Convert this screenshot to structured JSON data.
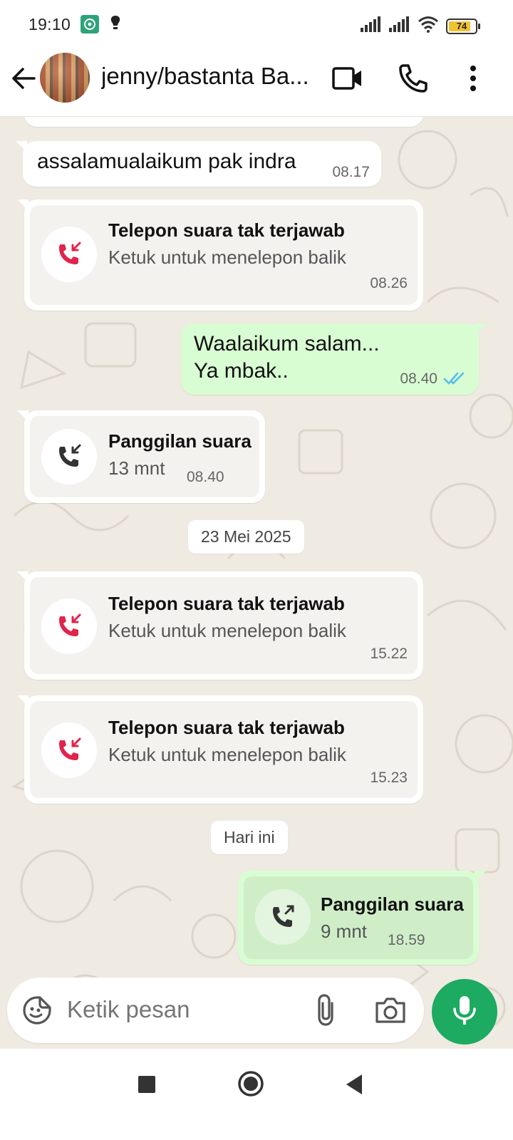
{
  "status_bar": {
    "time": "19:10",
    "battery_level": "74",
    "icons": [
      "hotspot-app-icon",
      "lightbulb-icon",
      "signal-icon",
      "signal-icon",
      "wifi-icon",
      "battery-icon"
    ]
  },
  "header": {
    "contact_name": "jenny/bastanta Ba...",
    "icons": [
      "back-arrow-icon",
      "video-call-icon",
      "phone-icon",
      "more-vert-icon"
    ]
  },
  "messages": [
    {
      "type": "text",
      "direction": "in",
      "text": "assalamualaikum pak indra",
      "time": "08.17"
    },
    {
      "type": "missed_call",
      "direction": "in",
      "title": "Telepon suara tak terjawab",
      "subtitle": "Ketuk untuk menelepon balik",
      "time": "08.26"
    },
    {
      "type": "text",
      "direction": "out",
      "lines": [
        "Waalaikum salam...",
        "Ya mbak.."
      ],
      "time": "08.40",
      "status": "read"
    },
    {
      "type": "call",
      "direction": "in",
      "title": "Panggilan suara",
      "subtitle": "13 mnt",
      "time": "08.40"
    },
    {
      "type": "missed_call",
      "direction": "in",
      "title": "Telepon suara tak terjawab",
      "subtitle": "Ketuk untuk menelepon balik",
      "time": "15.22"
    },
    {
      "type": "missed_call",
      "direction": "in",
      "title": "Telepon suara tak terjawab",
      "subtitle": "Ketuk untuk menelepon balik",
      "time": "15.23"
    },
    {
      "type": "call",
      "direction": "out",
      "title": "Panggilan suara",
      "subtitle": "9 mnt",
      "time": "18.59"
    }
  ],
  "date_separators": [
    "23 Mei 2025",
    "Hari ini"
  ],
  "input": {
    "placeholder": "Ketik pesan"
  },
  "colors": {
    "chat_background": "#efeae2",
    "outgoing_bubble": "#d9fdd3",
    "missed_call_red": "#e0244b",
    "accent_green": "#1daa61",
    "read_tick_blue": "#53bdeb"
  }
}
